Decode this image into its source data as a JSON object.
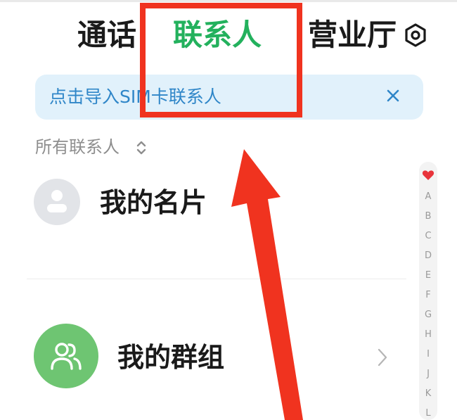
{
  "tabs": {
    "calls": "通话",
    "contacts": "联系人",
    "business_hall": "营业厅"
  },
  "active_tab_color": "#23b15d",
  "settings_icon": "settings-icon",
  "banner": {
    "text": "点击导入SIM卡联系人",
    "close_icon": "close-icon"
  },
  "filter": {
    "label": "所有联系人",
    "icon": "sort-updown-icon"
  },
  "rows": {
    "my_card": "我的名片",
    "my_groups": "我的群组"
  },
  "index": {
    "favorite_icon": "heart-icon",
    "letters": [
      "A",
      "B",
      "C",
      "D",
      "E",
      "F",
      "G",
      "H",
      "I",
      "J",
      "K",
      "L"
    ]
  },
  "annotation": {
    "color": "#f0331f"
  }
}
